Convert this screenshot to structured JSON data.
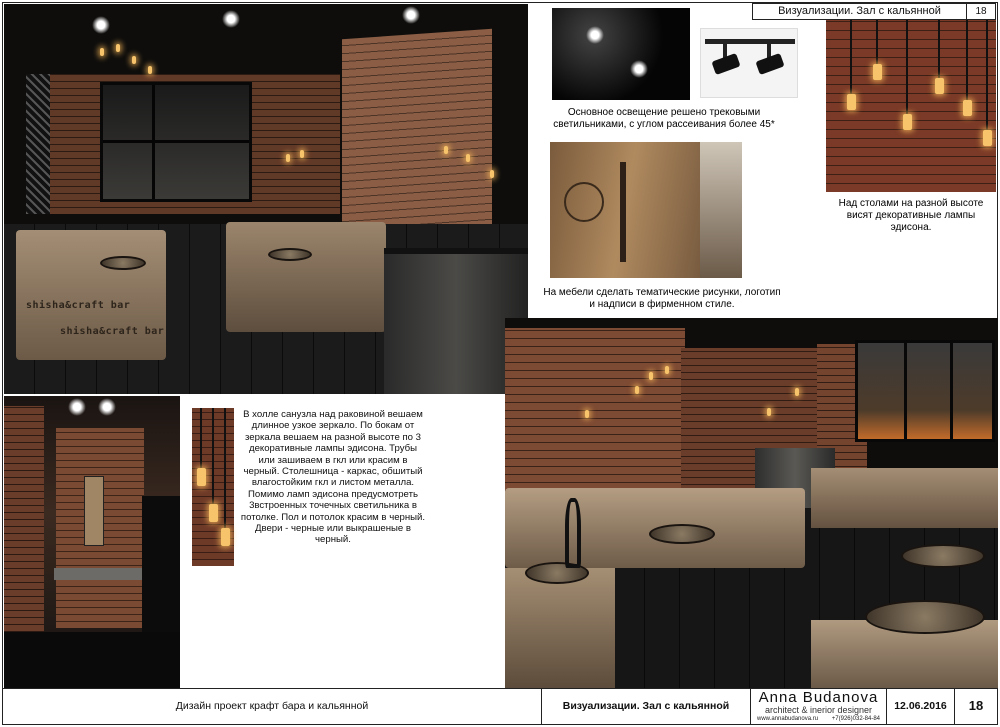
{
  "header": {
    "title": "Визуализации. Зал с кальянной",
    "page": "18"
  },
  "main_render": {
    "sign_1": "shisha&craft bar",
    "sign_2": "shisha&craft bar"
  },
  "captions": {
    "track_lights": "Основное освещение решено трековыми светильниками, с углом рассеивания более 45*",
    "edison_lamps": "Над столами на разной высоте висят декоративные лампы эдисона.",
    "furniture": "На мебели сделать тематические рисунки, логотип и надписи в фирменном стиле."
  },
  "hall_description": "В холле санузла над раковиной вешаем длинное узкое зеркало. По бокам от зеркала вешаем на разной высоте по 3 декоративные лампы эдисона. Трубы или зашиваем в гкл или красим в черный. Столешница - каркас, обшитый влагостойким гкл и листом металла. Помимо ламп эдисона предусмотреть 3встроенных точечных светильника в потолке. Пол и потолок красим в черный. Двери - черные или выкрашеные в черный.",
  "footer": {
    "project": "Дизайн проект крафт бара и кальянной",
    "view": "Визуализации. Зал с кальянной",
    "designer_name": "Anna Budanova",
    "designer_role": "architect & inerior designer",
    "website": "www.annabudanova.ru",
    "phone": "+7(926)032-84-84",
    "date": "12.06.2016",
    "page": "18"
  },
  "colors": {
    "brick": "#7a4a33",
    "wood": "#a48e75",
    "floor": "#141414"
  }
}
